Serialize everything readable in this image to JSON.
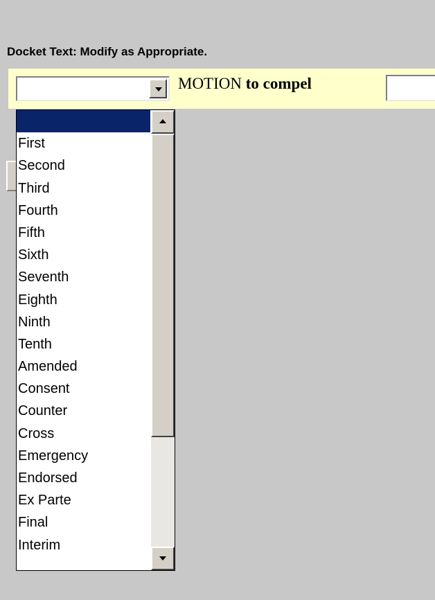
{
  "docket": {
    "heading": "Docket Text: Modify as Appropriate.",
    "motion_label": "MOTION",
    "motion_to": "to compel",
    "text_field_value": ""
  },
  "select": {
    "selected_value": "",
    "options": [
      "",
      "First",
      "Second",
      "Third",
      "Fourth",
      "Fifth",
      "Sixth",
      "Seventh",
      "Eighth",
      "Ninth",
      "Tenth",
      "Amended",
      "Consent",
      "Counter",
      "Cross",
      "Emergency",
      "Endorsed",
      "Ex Parte",
      "Final",
      "Interim"
    ],
    "highlighted_index": 0
  },
  "colors": {
    "page_background": "#c8c8c8",
    "docket_row_background": "#ffffcc",
    "selection_highlight": "#0a246a",
    "control_face": "#d4d0c8"
  },
  "icons": {
    "dropdown_arrow": "chevron-down-icon",
    "scroll_up": "arrow-up-icon",
    "scroll_down": "arrow-down-icon"
  }
}
